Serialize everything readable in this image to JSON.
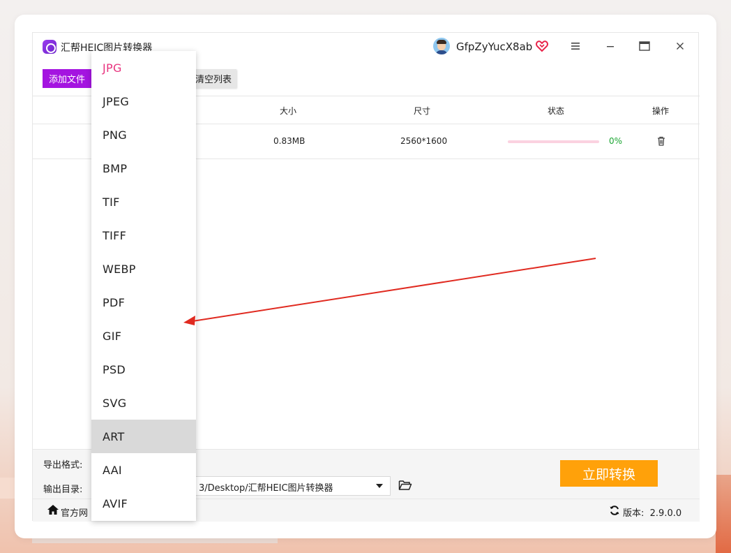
{
  "app": {
    "title": "汇帮HEIC图片转换器",
    "username": "GfpZyYucX8ab"
  },
  "toolbar": {
    "add_label": "添加文件",
    "clear_label": "清空列表"
  },
  "table": {
    "headers": [
      "大小",
      "尺寸",
      "状态",
      "操作"
    ],
    "rows": [
      {
        "size": "0.83MB",
        "dimensions": "2560*1600",
        "progress": 0,
        "percent": "0%"
      }
    ]
  },
  "format_dropdown": {
    "options": [
      "JPG",
      "JPEG",
      "PNG",
      "BMP",
      "TIF",
      "TIFF",
      "WEBP",
      "PDF",
      "GIF",
      "PSD",
      "SVG",
      "ART",
      "AAI",
      "AVIF"
    ],
    "selected": "JPG",
    "hovered": "ART"
  },
  "bottom": {
    "format_label": "导出格式:",
    "dir_label": "输出目录:",
    "dir_value": "3/Desktop/汇帮HEIC图片转换器",
    "convert_label": "立即转换",
    "home_label": "官方网",
    "version_label": "版本:",
    "version_value": "2.9.0.0"
  },
  "colors": {
    "accent_purple": "#a414e0",
    "convert_orange": "#ffa10a",
    "selected_pink": "#e8337e",
    "progress_track": "#fbd2e0",
    "percent_green": "#1aa531",
    "annotation_red": "#e02a20"
  }
}
